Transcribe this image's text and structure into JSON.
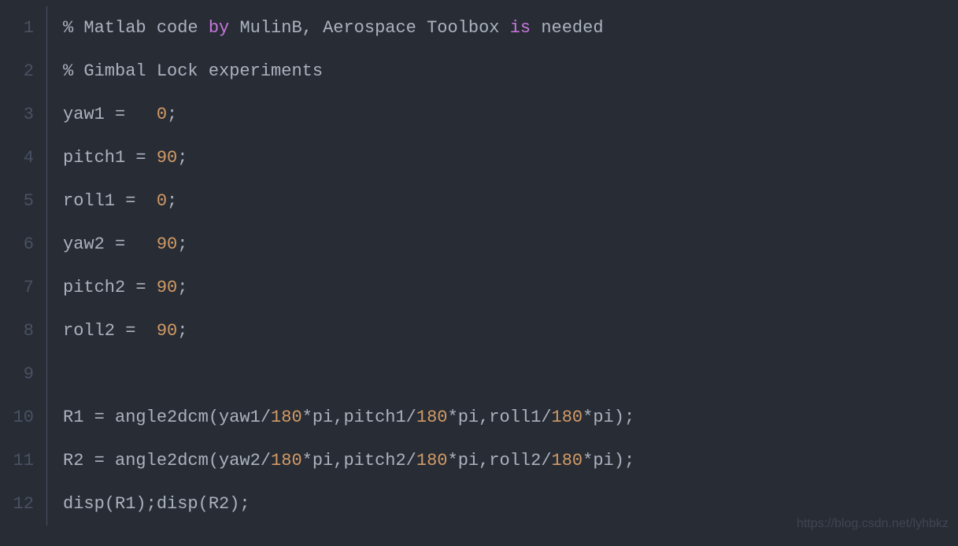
{
  "lineNumbers": [
    "1",
    "2",
    "3",
    "4",
    "5",
    "6",
    "7",
    "8",
    "9",
    "10",
    "11",
    "12"
  ],
  "watermark": "https://blog.csdn.net/lyhbkz",
  "code": {
    "line1": {
      "t1": "% Matlab code ",
      "t2": "by",
      "t3": " MulinB, Aerospace Toolbox ",
      "t4": "is",
      "t5": " needed"
    },
    "line2": {
      "t1": "% Gimbal Lock experiments"
    },
    "line3": {
      "t1": "yaw1 =   ",
      "t2": "0",
      "t3": ";"
    },
    "line4": {
      "t1": "pitch1 = ",
      "t2": "90",
      "t3": ";"
    },
    "line5": {
      "t1": "roll1 =  ",
      "t2": "0",
      "t3": ";"
    },
    "line6": {
      "t1": "yaw2 =   ",
      "t2": "90",
      "t3": ";"
    },
    "line7": {
      "t1": "pitch2 = ",
      "t2": "90",
      "t3": ";"
    },
    "line8": {
      "t1": "roll2 =  ",
      "t2": "90",
      "t3": ";"
    },
    "line9": {
      "t1": ""
    },
    "line10": {
      "t1": "R1 = angle2dcm(yaw1/",
      "t2": "180",
      "t3": "*pi,pitch1/",
      "t4": "180",
      "t5": "*pi,roll1/",
      "t6": "180",
      "t7": "*pi);"
    },
    "line11": {
      "t1": "R2 = angle2dcm(yaw2/",
      "t2": "180",
      "t3": "*pi,pitch2/",
      "t4": "180",
      "t5": "*pi,roll2/",
      "t6": "180",
      "t7": "*pi);"
    },
    "line12": {
      "t1": "disp(R1);disp(R2);"
    }
  }
}
